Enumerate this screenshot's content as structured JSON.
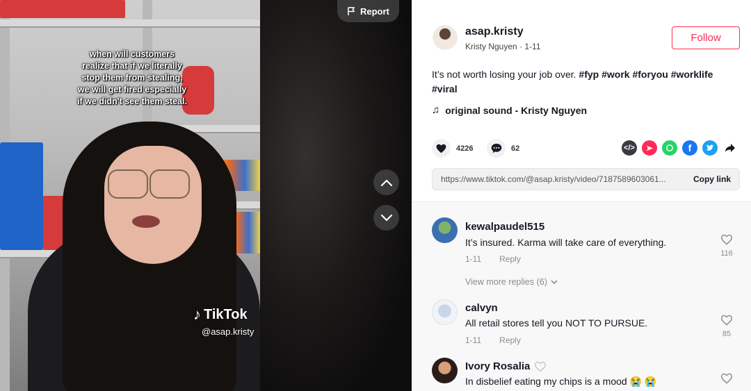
{
  "video": {
    "caption": "when will customers realize that if we literally stop them from stealing, we will get fired especially if we didn't see them steal.",
    "watermark_brand": "TikTok",
    "watermark_handle": "@asap.kristy",
    "report_label": "Report"
  },
  "author": {
    "username": "asap.kristy",
    "subline": "Kristy Nguyen · 1-11",
    "follow_label": "Follow"
  },
  "post": {
    "description_text": "It’s not worth losing your job over.",
    "hashtags": [
      "#fyp",
      "#work",
      "#foryou",
      "#worklife",
      "#viral"
    ],
    "sound": "original sound - Kristy Nguyen"
  },
  "stats": {
    "likes": "4226",
    "comments": "62"
  },
  "share": {
    "url": "https://www.tiktok.com/@asap.kristy/video/7187589603061...",
    "copy_label": "Copy link"
  },
  "comments": [
    {
      "username": "kewalpaudel515",
      "text": "It’s insured. Karma will take care of everything.",
      "date": "1-11",
      "reply_label": "Reply",
      "likes": "116"
    },
    {
      "username": "calvyn",
      "text": "All retail stores tell you NOT TO PURSUE.",
      "date": "1-11",
      "reply_label": "Reply",
      "likes": "85"
    },
    {
      "username": "Ivory Rosalia",
      "text": "In disbelief eating my chips is a mood 😭 😭"
    }
  ],
  "view_more_replies": "View more replies (6)",
  "colors": {
    "accent": "#fe2c55",
    "text": "#161823",
    "muted": "#8a8b91"
  }
}
